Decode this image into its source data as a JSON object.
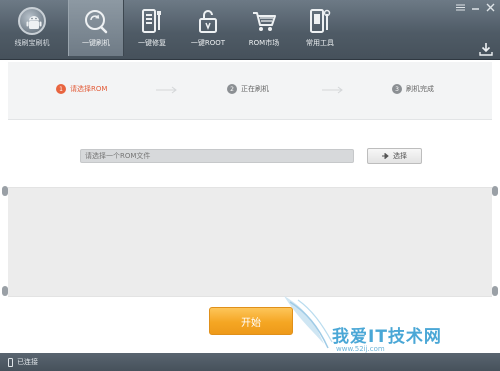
{
  "app": {
    "logo_label": "线刷宝刷机",
    "colors": {
      "accent": "#e8643f",
      "toolbar": "#4f5b66",
      "start_button": "#f5a623",
      "watermark": "#4aa7d6"
    }
  },
  "toolbar": {
    "items": [
      {
        "label": "一键刷机",
        "icon": "phone-refresh-icon",
        "active": true
      },
      {
        "label": "一键修复",
        "icon": "phone-wrench-icon",
        "active": false
      },
      {
        "label": "一键ROOT",
        "icon": "unlock-icon",
        "active": false
      },
      {
        "label": "ROM市场",
        "icon": "cart-icon",
        "active": false
      },
      {
        "label": "常用工具",
        "icon": "phone-tools-icon",
        "active": false
      }
    ],
    "window_buttons": [
      "menu-icon",
      "minimize-icon",
      "close-icon"
    ]
  },
  "steps": [
    {
      "num": "1",
      "label": "请选择ROM",
      "current": true
    },
    {
      "num": "2",
      "label": "正在刷机",
      "current": false
    },
    {
      "num": "3",
      "label": "刷机完成",
      "current": false
    }
  ],
  "file": {
    "placeholder": "请选择一个ROM文件",
    "choose_label": "选择"
  },
  "start_label": "开始",
  "status": {
    "text": "已连接"
  },
  "watermark": {
    "text": "我爱IT技术网",
    "url": "www.52ij.com"
  }
}
